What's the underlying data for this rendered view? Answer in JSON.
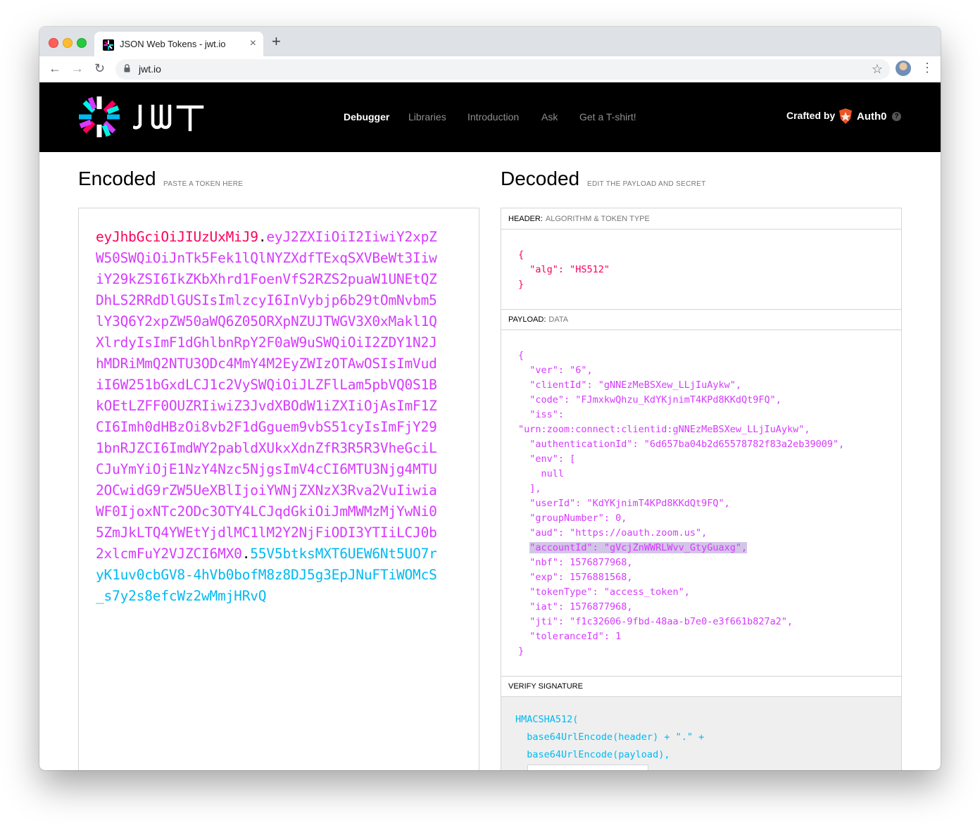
{
  "browser": {
    "tab_title": "JSON Web Tokens - jwt.io",
    "tab_close": "×",
    "new_tab": "+",
    "url": "jwt.io",
    "back": "←",
    "forward": "→",
    "reload": "↻",
    "bookmark": "☆",
    "menu": "⋮"
  },
  "site": {
    "nav": [
      "Debugger",
      "Libraries",
      "Introduction",
      "Ask",
      "Get a T-shirt!"
    ],
    "crafted_by": "Crafted by",
    "auth0": "Auth0",
    "help": "?"
  },
  "encoded": {
    "title": "Encoded",
    "subtitle": "PASTE A TOKEN HERE",
    "header_part": "eyJhbGciOiJIUzUxMiJ9",
    "payload_part": "eyJ2ZXIiOiI2IiwiY2xpZW50SWQiOiJnTk5Fek1lQlNYZXdfTExqSXVBeWt3IiwiY29kZSI6IkZKbXhrd1FoenVfS2RZS2puaW1UNEtQZDhLS2RRdDlGUSIsImlzcyI6InVybjp6b29tOmNvbm5lY3Q6Y2xpZW50aWQ6Z05ORXpNZUJTWGV3X0xMakl1QXlrdyIsImF1dGhlbnRpY2F0aW9uSWQiOiI2ZDY1N2JhMDRiMmQ2NTU3ODc4MmY4M2EyZWIzOTAwOSIsImVudiI6W251bGxdLCJ1c2VySWQiOiJLZFlLam5pbVQ0S1BkOEtLZFF0OUZRIiwiZ3JvdXBOdW1iZXIiOjAsImF1ZCI6Imh0dHBzOi8vb2F1dGguem9vbS51cyIsImFjY291bnRJZCI6ImdWY2pabldXUkxXdnZfR3R5R3VheGciLCJuYmYiOjE1NzY4Nzc5NjgsImV4cCI6MTU3Njg4MTU2OCwidG9rZW5UeXBlIjoiYWNjZXNzX3Rva2VuIiwiaWF0IjoxNTc2ODc3OTY4LCJqdGkiOiJmMWMzMjYwNi05ZmJkLTQ4YWEtYjdlMC1lM2Y2NjFiODI3YTIiLCJ0b2xlcmFuY2VJZCI6MX0",
    "signature_part": "55V5btksMXT6UEW6Nt5UO7ryK1uv0cbGV8-4hVb0bofM8z8DJ5g3EpJNuFTiWOMcS_s7y2s8efcWz2wMmjHRvQ",
    "dot": "."
  },
  "decoded": {
    "title": "Decoded",
    "subtitle": "EDIT THE PAYLOAD AND SECRET",
    "header_label": "HEADER:",
    "header_desc": "ALGORITHM & TOKEN TYPE",
    "header_json": "{\n  \"alg\": \"HS512\"\n}",
    "payload_label": "PAYLOAD:",
    "payload_desc": "DATA",
    "payload_json_before": "{\n  \"ver\": \"6\",\n  \"clientId\": \"gNNEzMeBSXew_LLjIuAykw\",\n  \"code\": \"FJmxkwQhzu_KdYKjnimT4KPd8KKdQt9FQ\",\n  \"iss\":\n\"urn:zoom:connect:clientid:gNNEzMeBSXew_LLjIuAykw\",\n  \"authenticationId\": \"6d657ba04b2d65578782f83a2eb39009\",\n  \"env\": [\n    null\n  ],\n  \"userId\": \"KdYKjnimT4KPd8KKdQt9FQ\",\n  \"groupNumber\": 0,\n  \"aud\": \"https://oauth.zoom.us\",\n  ",
    "payload_json_highlight": "\"accountId\": \"gVcjZnWWRLWvv_GtyGuaxg\",",
    "payload_json_after": "\n  \"nbf\": 1576877968,\n  \"exp\": 1576881568,\n  \"tokenType\": \"access_token\",\n  \"iat\": 1576877968,\n  \"jti\": \"f1c32606-9fbd-48aa-b7e0-e3f661b827a2\",\n  \"toleranceId\": 1\n}",
    "verify_label": "VERIFY SIGNATURE",
    "verify_code": "HMACSHA512(\n  base64UrlEncode(header) + \".\" +\n  base64UrlEncode(payload),"
  }
}
